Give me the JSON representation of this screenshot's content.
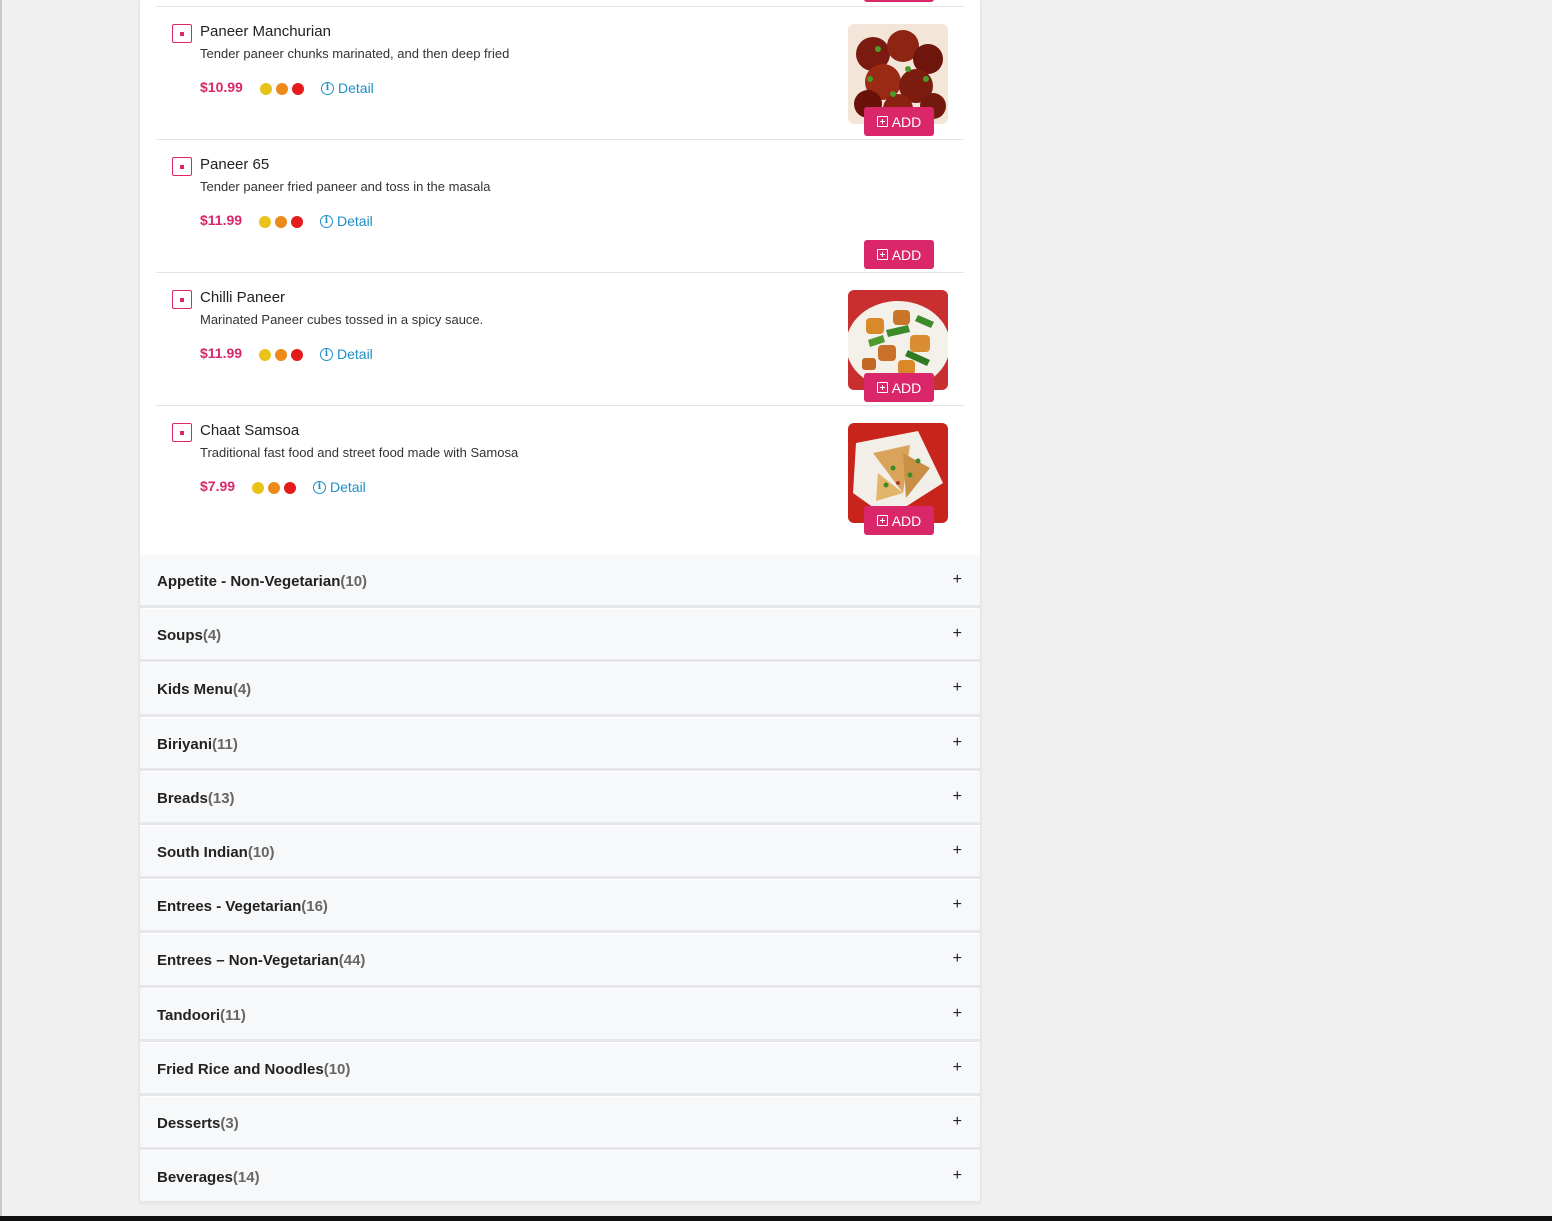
{
  "colors": {
    "accent": "#d9276a",
    "link": "#1e8fc6",
    "spice_levels": [
      "#e9c21a",
      "#ec8a1b",
      "#e31b1b"
    ]
  },
  "items": [
    {
      "name": "Paneer Manchurian",
      "description": "Tender paneer chunks marinated, and then deep fried",
      "price": "$10.99",
      "detail_label": "Detail",
      "add_label": "ADD",
      "has_image": true,
      "image_icon": "manchurian-photo"
    },
    {
      "name": "Paneer 65",
      "description": "Tender paneer fried paneer and toss in the masala",
      "price": "$11.99",
      "detail_label": "Detail",
      "add_label": "ADD",
      "has_image": false
    },
    {
      "name": "Chilli Paneer",
      "description": "Marinated Paneer cubes tossed in a spicy sauce.",
      "price": "$11.99",
      "detail_label": "Detail",
      "add_label": "ADD",
      "has_image": true,
      "image_icon": "chilli-paneer-photo"
    },
    {
      "name": "Chaat Samsoa",
      "description": "Traditional fast food and street food made with Samosa",
      "price": "$7.99",
      "detail_label": "Detail",
      "add_label": "ADD",
      "has_image": true,
      "image_icon": "samosa-photo"
    }
  ],
  "categories": [
    {
      "name": "Appetite - Non-Vegetarian",
      "count": "(10)"
    },
    {
      "name": "Soups",
      "count": "(4)"
    },
    {
      "name": "Kids Menu",
      "count": "(4)"
    },
    {
      "name": "Biriyani",
      "count": "(11)"
    },
    {
      "name": "Breads",
      "count": "(13)"
    },
    {
      "name": "South Indian",
      "count": "(10)"
    },
    {
      "name": "Entrees - Vegetarian",
      "count": "(16)"
    },
    {
      "name": "Entrees – Non-Vegetarian",
      "count": "(44)"
    },
    {
      "name": "Tandoori",
      "count": "(11)"
    },
    {
      "name": "Fried Rice and Noodles",
      "count": "(10)"
    },
    {
      "name": "Desserts",
      "count": "(3)"
    },
    {
      "name": "Beverages",
      "count": "(14)"
    }
  ],
  "expand_symbol": "+"
}
